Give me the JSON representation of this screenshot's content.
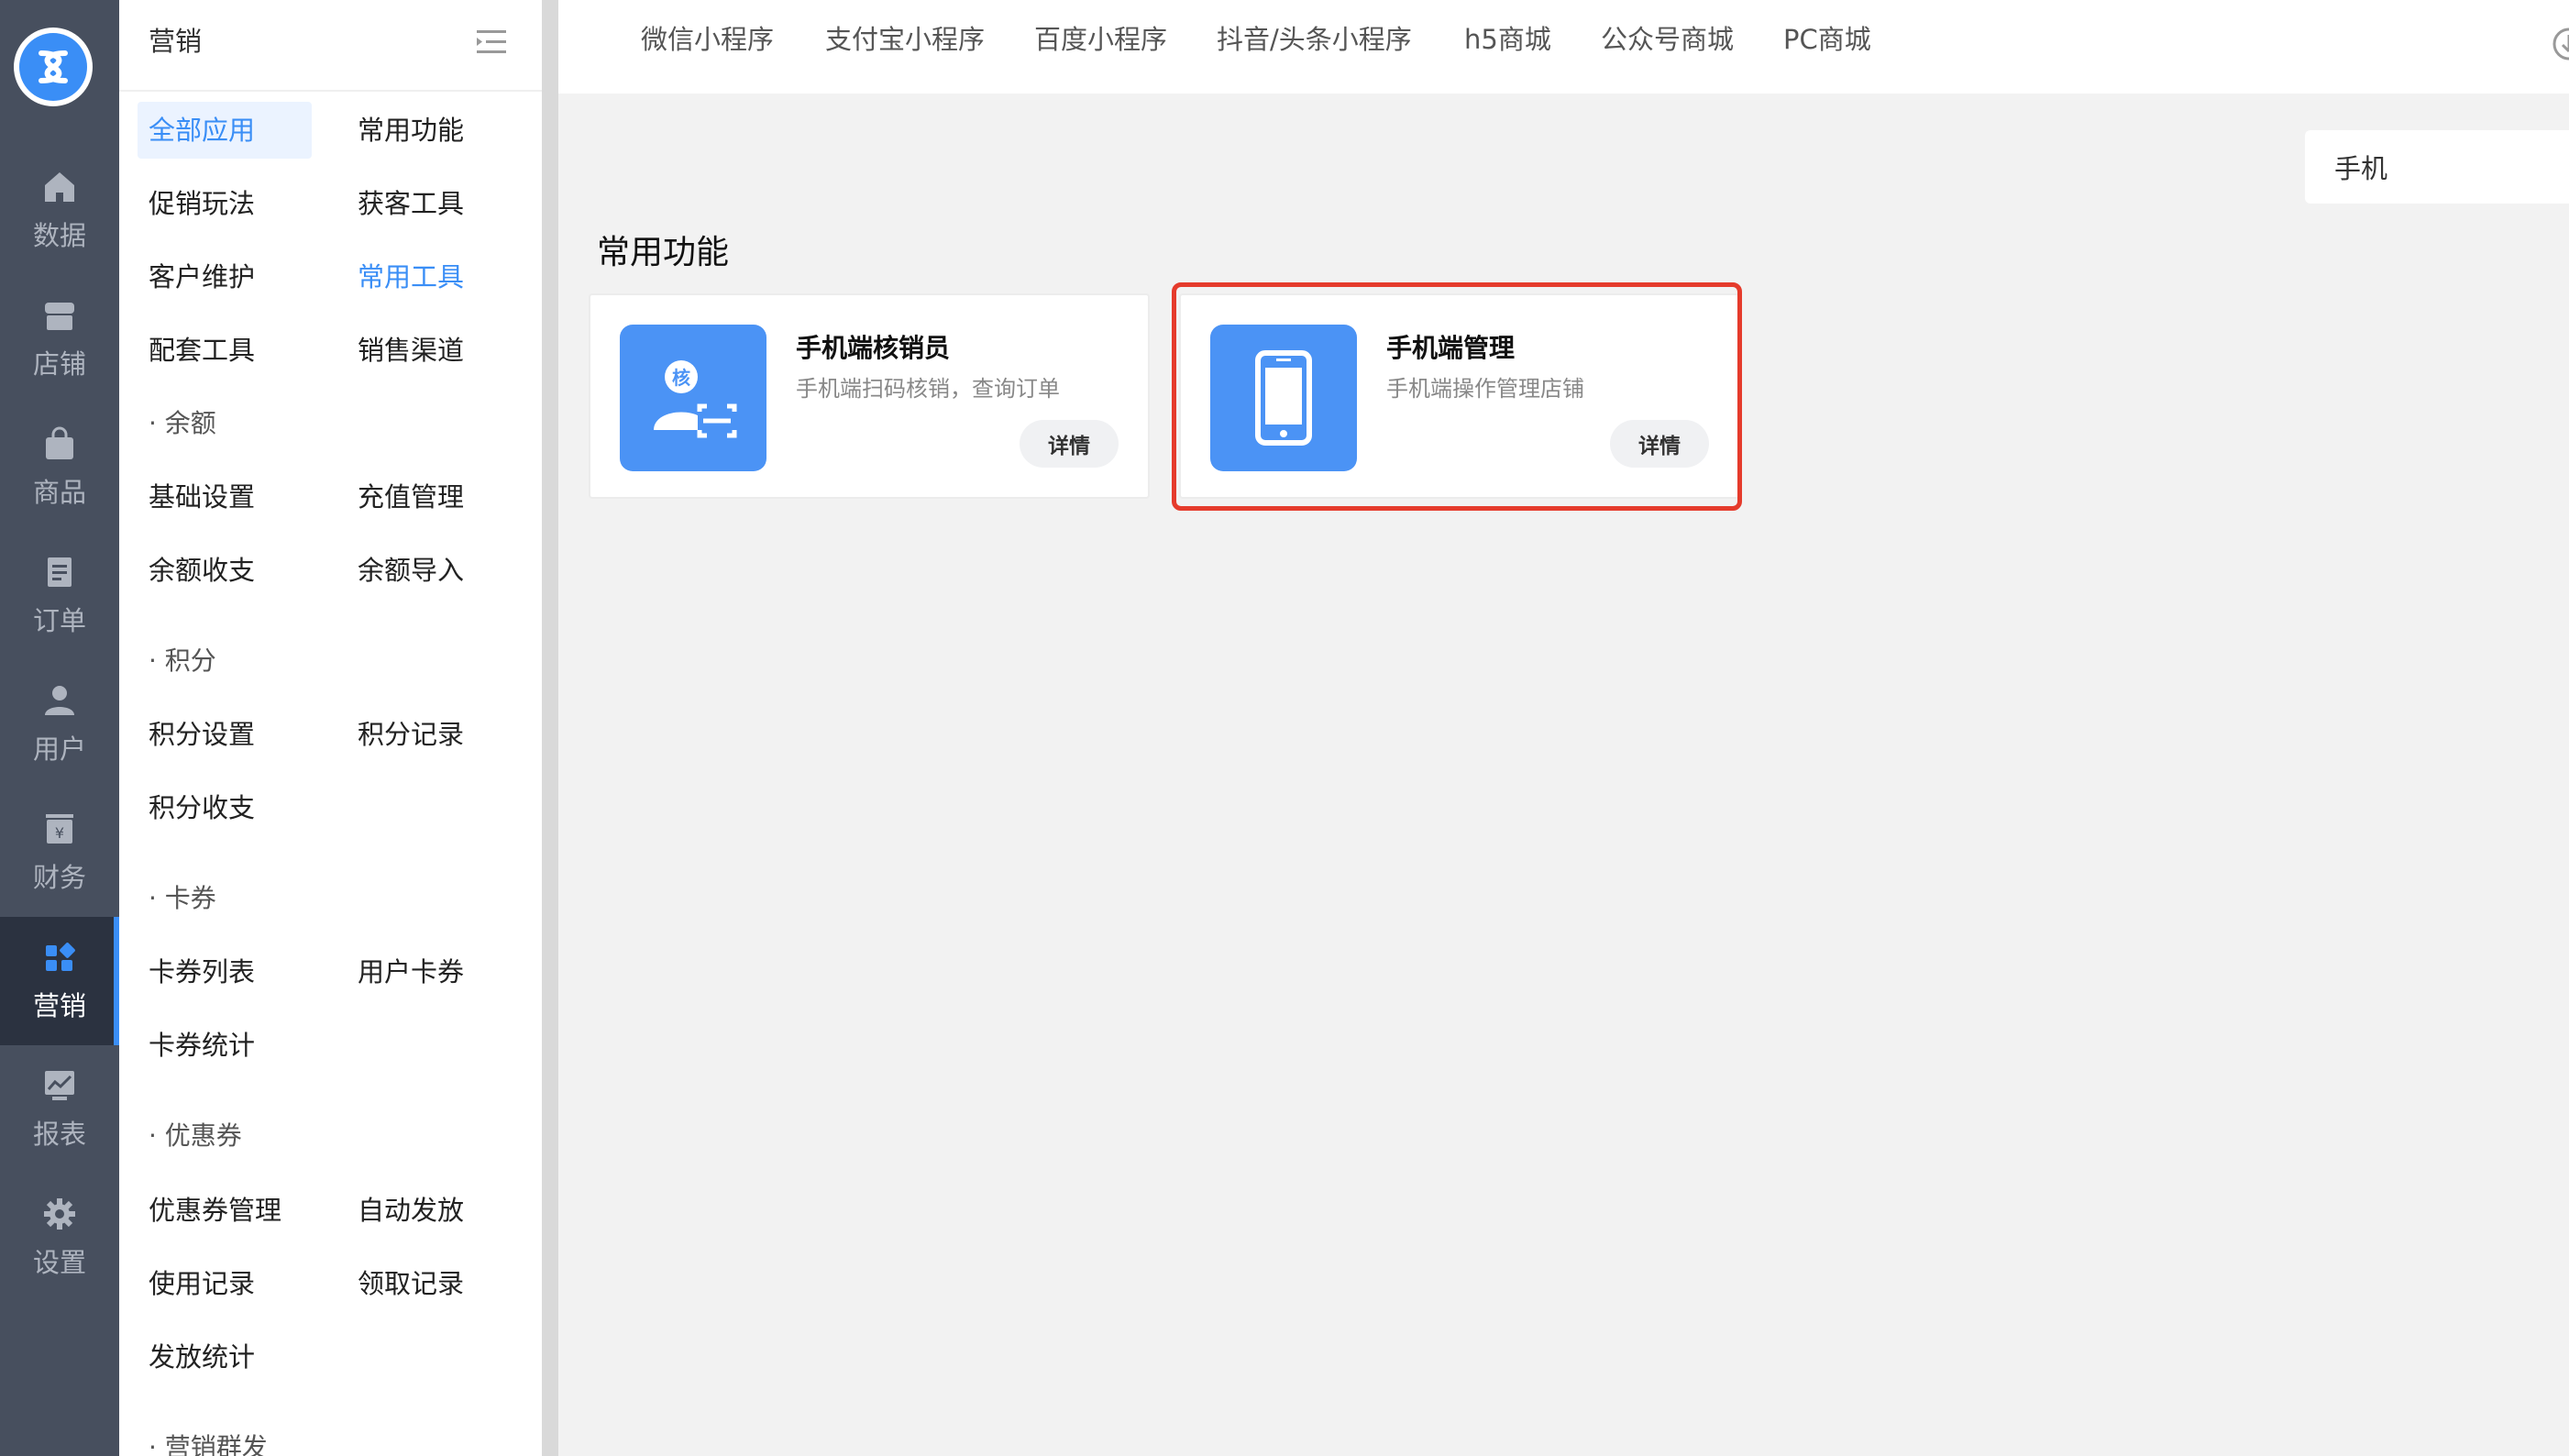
{
  "rail": {
    "items": [
      {
        "label": "数据",
        "icon": "home-icon"
      },
      {
        "label": "店铺",
        "icon": "store-icon"
      },
      {
        "label": "商品",
        "icon": "bag-icon"
      },
      {
        "label": "订单",
        "icon": "document-icon"
      },
      {
        "label": "用户",
        "icon": "user-icon"
      },
      {
        "label": "财务",
        "icon": "finance-icon"
      },
      {
        "label": "营销",
        "icon": "apps-icon",
        "active": true
      },
      {
        "label": "报表",
        "icon": "chart-icon"
      },
      {
        "label": "设置",
        "icon": "gear-icon"
      }
    ]
  },
  "menu": {
    "title": "营销",
    "items": [
      [
        "全部应用",
        "常用功能"
      ],
      [
        "促销玩法",
        "获客工具"
      ],
      [
        "客户维护",
        "常用工具"
      ],
      [
        "配套工具",
        "销售渠道"
      ]
    ],
    "groups": [
      {
        "title": "· 余额",
        "items": [
          [
            "基础设置",
            "充值管理"
          ],
          [
            "余额收支",
            "余额导入"
          ]
        ]
      },
      {
        "title": "· 积分",
        "items": [
          [
            "积分设置",
            "积分记录"
          ],
          [
            "积分收支",
            ""
          ]
        ]
      },
      {
        "title": "· 卡券",
        "items": [
          [
            "卡券列表",
            "用户卡券"
          ],
          [
            "卡券统计",
            ""
          ]
        ]
      },
      {
        "title": "· 优惠券",
        "items": [
          [
            "优惠券管理",
            "自动发放"
          ],
          [
            "使用记录",
            "领取记录"
          ],
          [
            "发放统计",
            ""
          ]
        ]
      },
      {
        "title": "· 营销群发",
        "items": []
      }
    ]
  },
  "tabs": [
    "微信小程序",
    "支付宝小程序",
    "百度小程序",
    "抖音/头条小程序",
    "h5商城",
    "公众号商城",
    "PC商城"
  ],
  "search": {
    "value": "手机"
  },
  "section": {
    "title": "常用功能"
  },
  "cards": [
    {
      "title": "手机端核销员",
      "desc": "手机端扫码核销，查询订单",
      "button": "详情",
      "icon": "verify-user-icon",
      "icon_text": "核"
    },
    {
      "title": "手机端管理",
      "desc": "手机端操作管理店铺",
      "button": "详情",
      "icon": "phone-icon"
    }
  ],
  "colors": {
    "accent": "#3a8ef6",
    "rail": "#474f5e",
    "highlight": "#e53b2c"
  }
}
